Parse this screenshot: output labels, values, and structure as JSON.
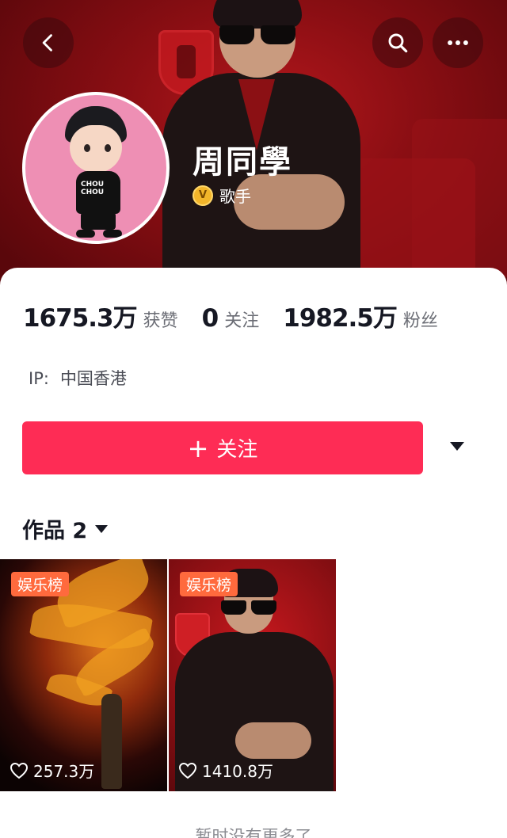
{
  "header": {
    "back_icon": "chevron-left-icon",
    "search_icon": "search-icon",
    "more_icon": "more-horizontal-icon"
  },
  "profile": {
    "name": "周同學",
    "verify_badge": "V",
    "verify_label": "歌手",
    "avatar_shirt_text": "CHOU\nCHOU"
  },
  "stats": {
    "likes_count": "1675.3万",
    "likes_label": "获赞",
    "following_count": "0",
    "following_label": "关注",
    "followers_count": "1982.5万",
    "followers_label": "粉丝"
  },
  "ip": {
    "label": "IP:",
    "value": "中国香港"
  },
  "actions": {
    "follow_plus": "+",
    "follow_label": "关注"
  },
  "works": {
    "label": "作品 2",
    "items": [
      {
        "tag": "娱乐榜",
        "likes": "257.3万"
      },
      {
        "tag": "娱乐榜",
        "likes": "1410.8万"
      }
    ]
  },
  "footer": {
    "no_more": "暂时没有更多了"
  },
  "colors": {
    "accent": "#fe2c55",
    "tag": "#ff6a3d",
    "banner": "#8a0e13",
    "verify": "#f2b52a"
  }
}
